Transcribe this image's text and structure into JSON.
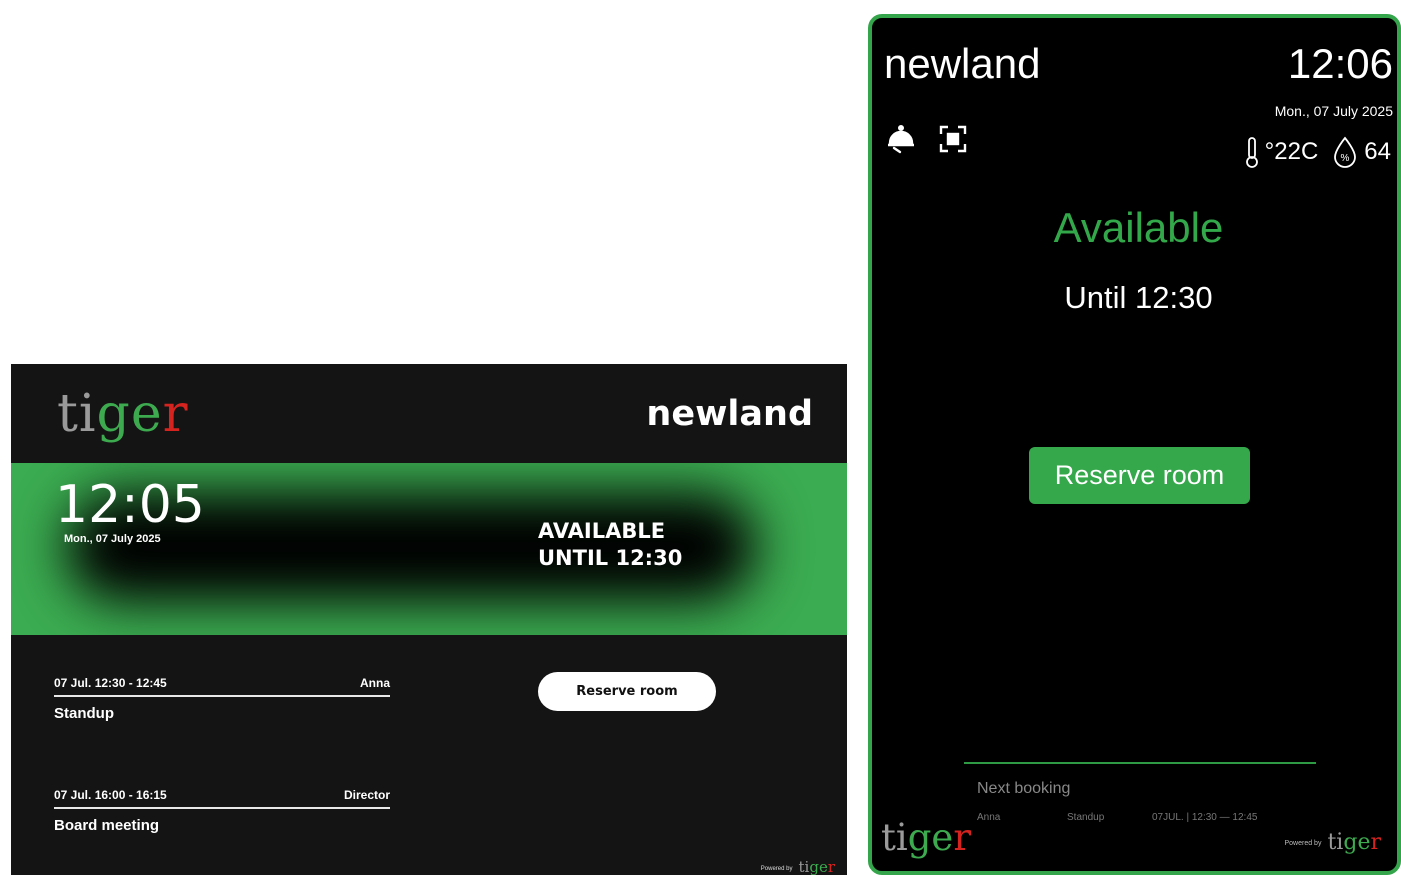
{
  "landscape": {
    "logo": {
      "t": "t",
      "i": "i",
      "g": "g",
      "e": "e",
      "r": "r"
    },
    "room_name": "newland",
    "time": "12:05",
    "date": "Mon., 07 July 2025",
    "status_line1": "AVAILABLE",
    "status_line2": "UNTIL 12:30",
    "reserve_label": "Reserve room",
    "bookings": [
      {
        "when": "07  Jul. 12:30 - 12:45",
        "organizer": "Anna",
        "title": "Standup"
      },
      {
        "when": "07  Jul. 16:00 - 16:15",
        "organizer": "Director",
        "title": "Board meeting"
      }
    ],
    "powered_by": "Powered by",
    "powered_logo": "tiger"
  },
  "portrait": {
    "room_name": "newland",
    "time": "12:06",
    "date": "Mon., 07 July 2025",
    "temperature": "°22C",
    "humidity": "64",
    "status": "Available",
    "until": "Until 12:30",
    "reserve_label": "Reserve room",
    "next_booking_label": "Next booking",
    "next_booking": {
      "organizer": "Anna",
      "title": "Standup",
      "when": "07JUL.  |  12:30 — 12:45"
    },
    "logo": {
      "t": "t",
      "i": "i",
      "g": "g",
      "e": "e",
      "r": "r"
    },
    "powered_by": "Powered by",
    "powered_logo": "tiger"
  },
  "icons": [
    "room-service-icon",
    "scan-icon",
    "thermometer-icon",
    "humidity-icon"
  ],
  "colors": {
    "accent_green": "#3bac51",
    "logo_red": "#d52420",
    "logo_grey": "#9a9a9a",
    "panel_bg": "#141414"
  }
}
